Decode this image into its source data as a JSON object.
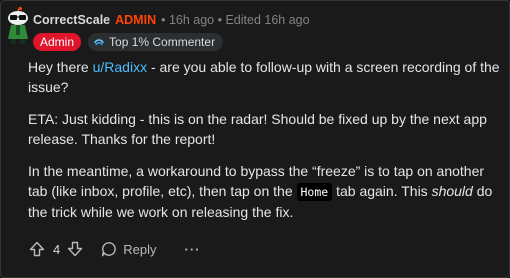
{
  "comment": {
    "username": "CorrectScale",
    "admin_tag": "ADMIN",
    "meta": "• 16h ago • Edited 16h ago",
    "flairs": {
      "admin": "Admin",
      "top_commenter": "Top 1% Commenter"
    },
    "body": {
      "p1_before": "Hey there ",
      "p1_link": "u/Radixx",
      "p1_after": " - are you able to follow-up with a screen recording of the issue?",
      "p2": "ETA: Just kidding - this is on the radar! Should be fixed up by the next app release. Thanks for the report!",
      "p3_before": "In the meantime, a workaround to bypass the “freeze” is to tap on another tab (like inbox, profile, etc), then tap on the ",
      "p3_code": "Home",
      "p3_middle": " tab again. This ",
      "p3_em": "should",
      "p3_after": " do the trick while we work on releasing the fix."
    },
    "actions": {
      "vote_count": "4",
      "reply_label": "Reply",
      "more_label": "···"
    }
  },
  "colors": {
    "admin_accent": "#ff4500",
    "flair_admin_bg": "#e0142b",
    "link": "#4fbcff",
    "card_bg": "#1a1a1b"
  },
  "icons": [
    "snoo-avatar-icon",
    "award-icon",
    "upvote-icon",
    "downvote-icon",
    "reply-bubble-icon",
    "more-dots-icon"
  ]
}
